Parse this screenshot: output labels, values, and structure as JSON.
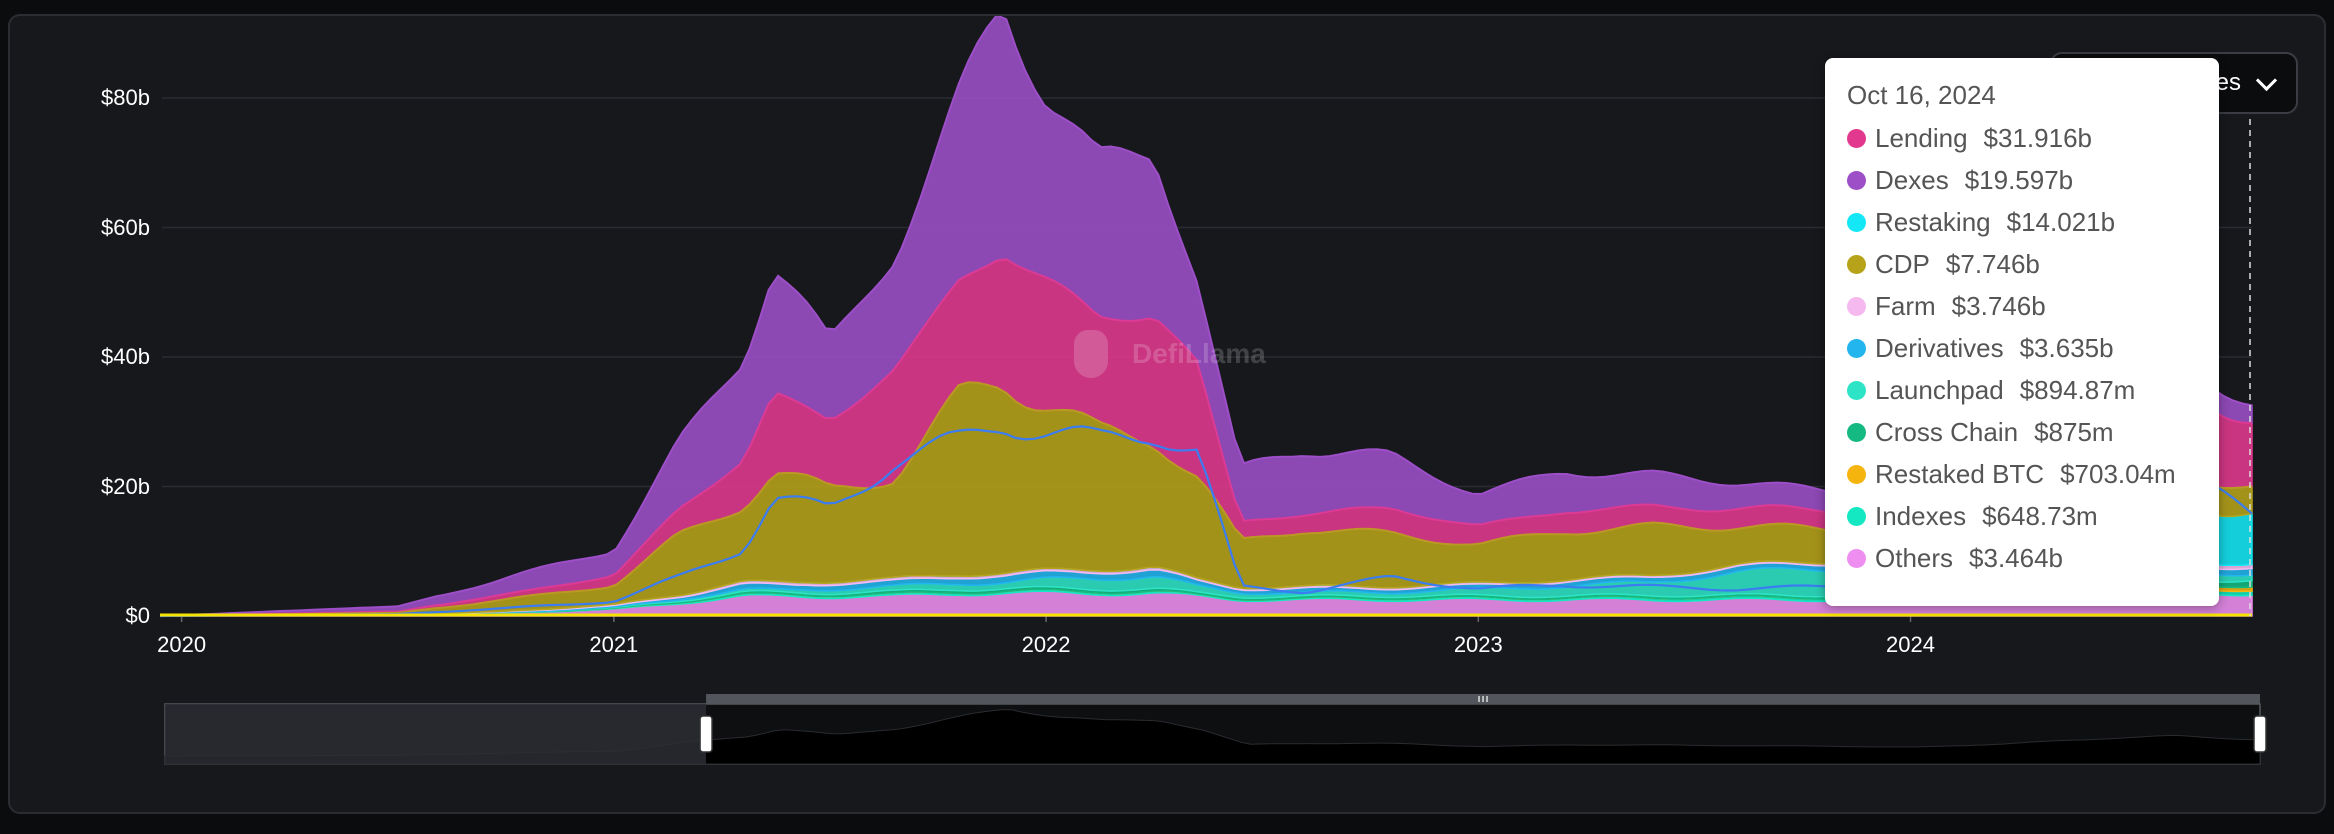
{
  "chart_data": {
    "type": "area",
    "stacked": true,
    "brand": "DefiLlama",
    "y_axis": {
      "ticks": [
        "$0",
        "$20b",
        "$40b",
        "$60b",
        "$80b"
      ],
      "ylim": [
        0,
        80
      ],
      "unit": "$b"
    },
    "x_axis": {
      "ticks": [
        "2020",
        "2021",
        "2022",
        "2023",
        "2024"
      ],
      "xlim": [
        2019.95,
        2024.79
      ]
    },
    "grid": true,
    "x": [
      2019.95,
      2020.5,
      2020.75,
      2021.0,
      2021.15,
      2021.3,
      2021.37,
      2021.5,
      2021.65,
      2021.8,
      2021.9,
      2022.0,
      2022.12,
      2022.25,
      2022.35,
      2022.45,
      2022.6,
      2022.8,
      2023.0,
      2023.2,
      2023.4,
      2023.6,
      2023.8,
      2024.0,
      2024.2,
      2024.4,
      2024.6,
      2024.79
    ],
    "series": [
      {
        "name": "Lending",
        "color": "#e2398f",
        "values": [
          0,
          0.2,
          0.8,
          1.5,
          4,
          7,
          12,
          11,
          16,
          18,
          20,
          19,
          18,
          19,
          17,
          3,
          2.5,
          4,
          2.8,
          3.2,
          3.0,
          2.8,
          3.0,
          3.2,
          8,
          13,
          15,
          10.5
        ]
      },
      {
        "name": "Dexes",
        "color": "#9d4fc8",
        "values": [
          0,
          0.8,
          2.5,
          4.0,
          10,
          16,
          20,
          12,
          18,
          28,
          38,
          29,
          24,
          25,
          13,
          8,
          10,
          8,
          5,
          6,
          5,
          4,
          3,
          2.5,
          3,
          3,
          4,
          2.5
        ]
      },
      {
        "name": "Restaking",
        "color": "#14e7f5",
        "values": [
          0,
          0,
          0,
          0,
          0,
          0,
          0,
          0,
          0,
          0,
          0,
          0,
          0,
          0,
          0,
          0,
          0,
          0,
          0,
          0,
          0,
          0,
          0,
          0,
          2,
          7,
          9,
          8
        ]
      },
      {
        "name": "CDP",
        "color": "#b7a31a",
        "values": [
          0,
          0.3,
          1.8,
          3.0,
          9,
          12,
          17,
          14,
          16,
          27,
          30,
          26,
          21,
          20,
          16,
          7,
          9,
          8,
          6,
          7.5,
          7.5,
          6,
          5,
          4,
          4,
          4,
          4,
          4
        ]
      },
      {
        "name": "Farm",
        "color": "#f5b9f0",
        "values": [
          0,
          0,
          0.1,
          0.2,
          0.3,
          0.4,
          0.4,
          0.4,
          0.4,
          0.4,
          0.4,
          0.4,
          0.4,
          0.4,
          0.3,
          0.3,
          0.3,
          0.3,
          0.3,
          0.3,
          0.3,
          0.3,
          0.3,
          0.3,
          0.3,
          0.5,
          0.6,
          0.6
        ]
      },
      {
        "name": "Derivatives",
        "color": "#22b5ee",
        "values": [
          0,
          0,
          0.1,
          0.2,
          0.4,
          0.8,
          0.8,
          0.8,
          0.8,
          1.0,
          1.0,
          1.0,
          1.0,
          1.0,
          0.8,
          0.6,
          0.6,
          0.6,
          0.6,
          0.7,
          0.8,
          0.8,
          0.8,
          0.8,
          0.9,
          1.0,
          1.0,
          1.0
        ]
      },
      {
        "name": "Launchpad",
        "color": "#2de4c6",
        "values": [
          0,
          0,
          0,
          0.1,
          0.2,
          0.4,
          0.4,
          0.6,
          0.8,
          0.9,
          1.0,
          1.4,
          1.6,
          2.0,
          1.0,
          0.6,
          0.6,
          0.6,
          1.0,
          1.5,
          2.0,
          3.5,
          4.2,
          3.6,
          2.0,
          1.5,
          1.2,
          0.9
        ]
      },
      {
        "name": "Cross Chain",
        "color": "#15b982",
        "values": [
          0,
          0,
          0,
          0.1,
          0.2,
          0.3,
          0.3,
          0.3,
          0.4,
          0.4,
          0.4,
          0.4,
          0.4,
          0.4,
          0.3,
          0.3,
          0.3,
          0.3,
          0.3,
          0.3,
          0.3,
          0.3,
          0.3,
          0.3,
          0.4,
          0.5,
          0.6,
          0.9
        ]
      },
      {
        "name": "Restaked BTC",
        "color": "#f6b40e",
        "values": [
          0,
          0,
          0,
          0,
          0,
          0,
          0,
          0,
          0,
          0,
          0,
          0,
          0,
          0,
          0,
          0,
          0,
          0,
          0,
          0,
          0,
          0,
          0,
          0,
          0,
          0.1,
          0.4,
          0.7
        ]
      },
      {
        "name": "Indexes",
        "color": "#13e8c2",
        "values": [
          0,
          0,
          0.05,
          0.1,
          0.2,
          0.3,
          0.3,
          0.3,
          0.3,
          0.3,
          0.3,
          0.3,
          0.3,
          0.3,
          0.2,
          0.2,
          0.2,
          0.3,
          0.3,
          0.3,
          0.4,
          0.4,
          0.4,
          0.5,
          0.5,
          0.6,
          0.6,
          0.6
        ]
      },
      {
        "name": "Others",
        "color": "#ee8ef0",
        "values": [
          0,
          0.2,
          0.5,
          1.0,
          2.0,
          3.0,
          3.0,
          3.0,
          3.0,
          3.5,
          3.5,
          3.5,
          3.5,
          3.5,
          3.0,
          2.5,
          2.5,
          2.5,
          2.5,
          2.5,
          2.5,
          2.5,
          2.5,
          2.5,
          2.8,
          3.2,
          3.4,
          3.5
        ]
      }
    ],
    "overlay_line": {
      "name": "Lending",
      "color": "#3b7cf0"
    },
    "navigator": {
      "range_start": 2021.2,
      "range_end": 2024.79
    }
  },
  "controls": {
    "series_button_label": "Series"
  },
  "tooltip": {
    "date": "Oct 16, 2024",
    "rows": [
      {
        "name": "Lending",
        "value": "$31.916b",
        "color": "#e2398f"
      },
      {
        "name": "Dexes",
        "value": "$19.597b",
        "color": "#9d4fc8"
      },
      {
        "name": "Restaking",
        "value": "$14.021b",
        "color": "#14e7f5"
      },
      {
        "name": "CDP",
        "value": "$7.746b",
        "color": "#b7a31a"
      },
      {
        "name": "Farm",
        "value": "$3.746b",
        "color": "#f5b9f0"
      },
      {
        "name": "Derivatives",
        "value": "$3.635b",
        "color": "#22b5ee"
      },
      {
        "name": "Launchpad",
        "value": "$894.87m",
        "color": "#2de4c6"
      },
      {
        "name": "Cross Chain",
        "value": "$875m",
        "color": "#15b982"
      },
      {
        "name": "Restaked BTC",
        "value": "$703.04m",
        "color": "#f6b40e"
      },
      {
        "name": "Indexes",
        "value": "$648.73m",
        "color": "#13e8c2"
      },
      {
        "name": "Others",
        "value": "$3.464b",
        "color": "#ee8ef0"
      }
    ]
  }
}
